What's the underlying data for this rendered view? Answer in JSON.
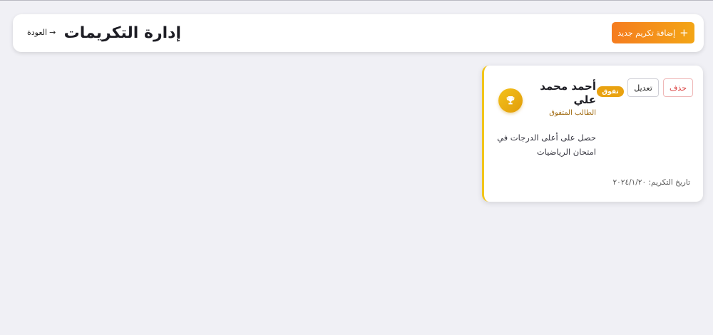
{
  "header": {
    "add_button_label": "إضافة تكريم جديد",
    "add_icon": "+",
    "title": "إدارة التكريمات",
    "back_label": "العودة",
    "back_icon": "→"
  },
  "honors": [
    {
      "name": "أحمد محمد علي",
      "subtitle": "الطالب المتفوق",
      "badge": "تفوق",
      "edit_label": "تعديل",
      "delete_label": "حذف",
      "description": "حصل على أعلى الدرجات في امتحان الرياضيات",
      "date_label": "تاريخ التكريم:",
      "date_value": "٢٠٢٤/١/٢٠",
      "icon": "trophy-icon",
      "accent_color": "#f2c51a"
    }
  ],
  "colors": {
    "primary_gradient_start": "#f57c1f",
    "primary_gradient_end": "#f3a515",
    "badge": "#e9a210",
    "delete": "#d93a3a",
    "background": "#f0f0f5"
  }
}
